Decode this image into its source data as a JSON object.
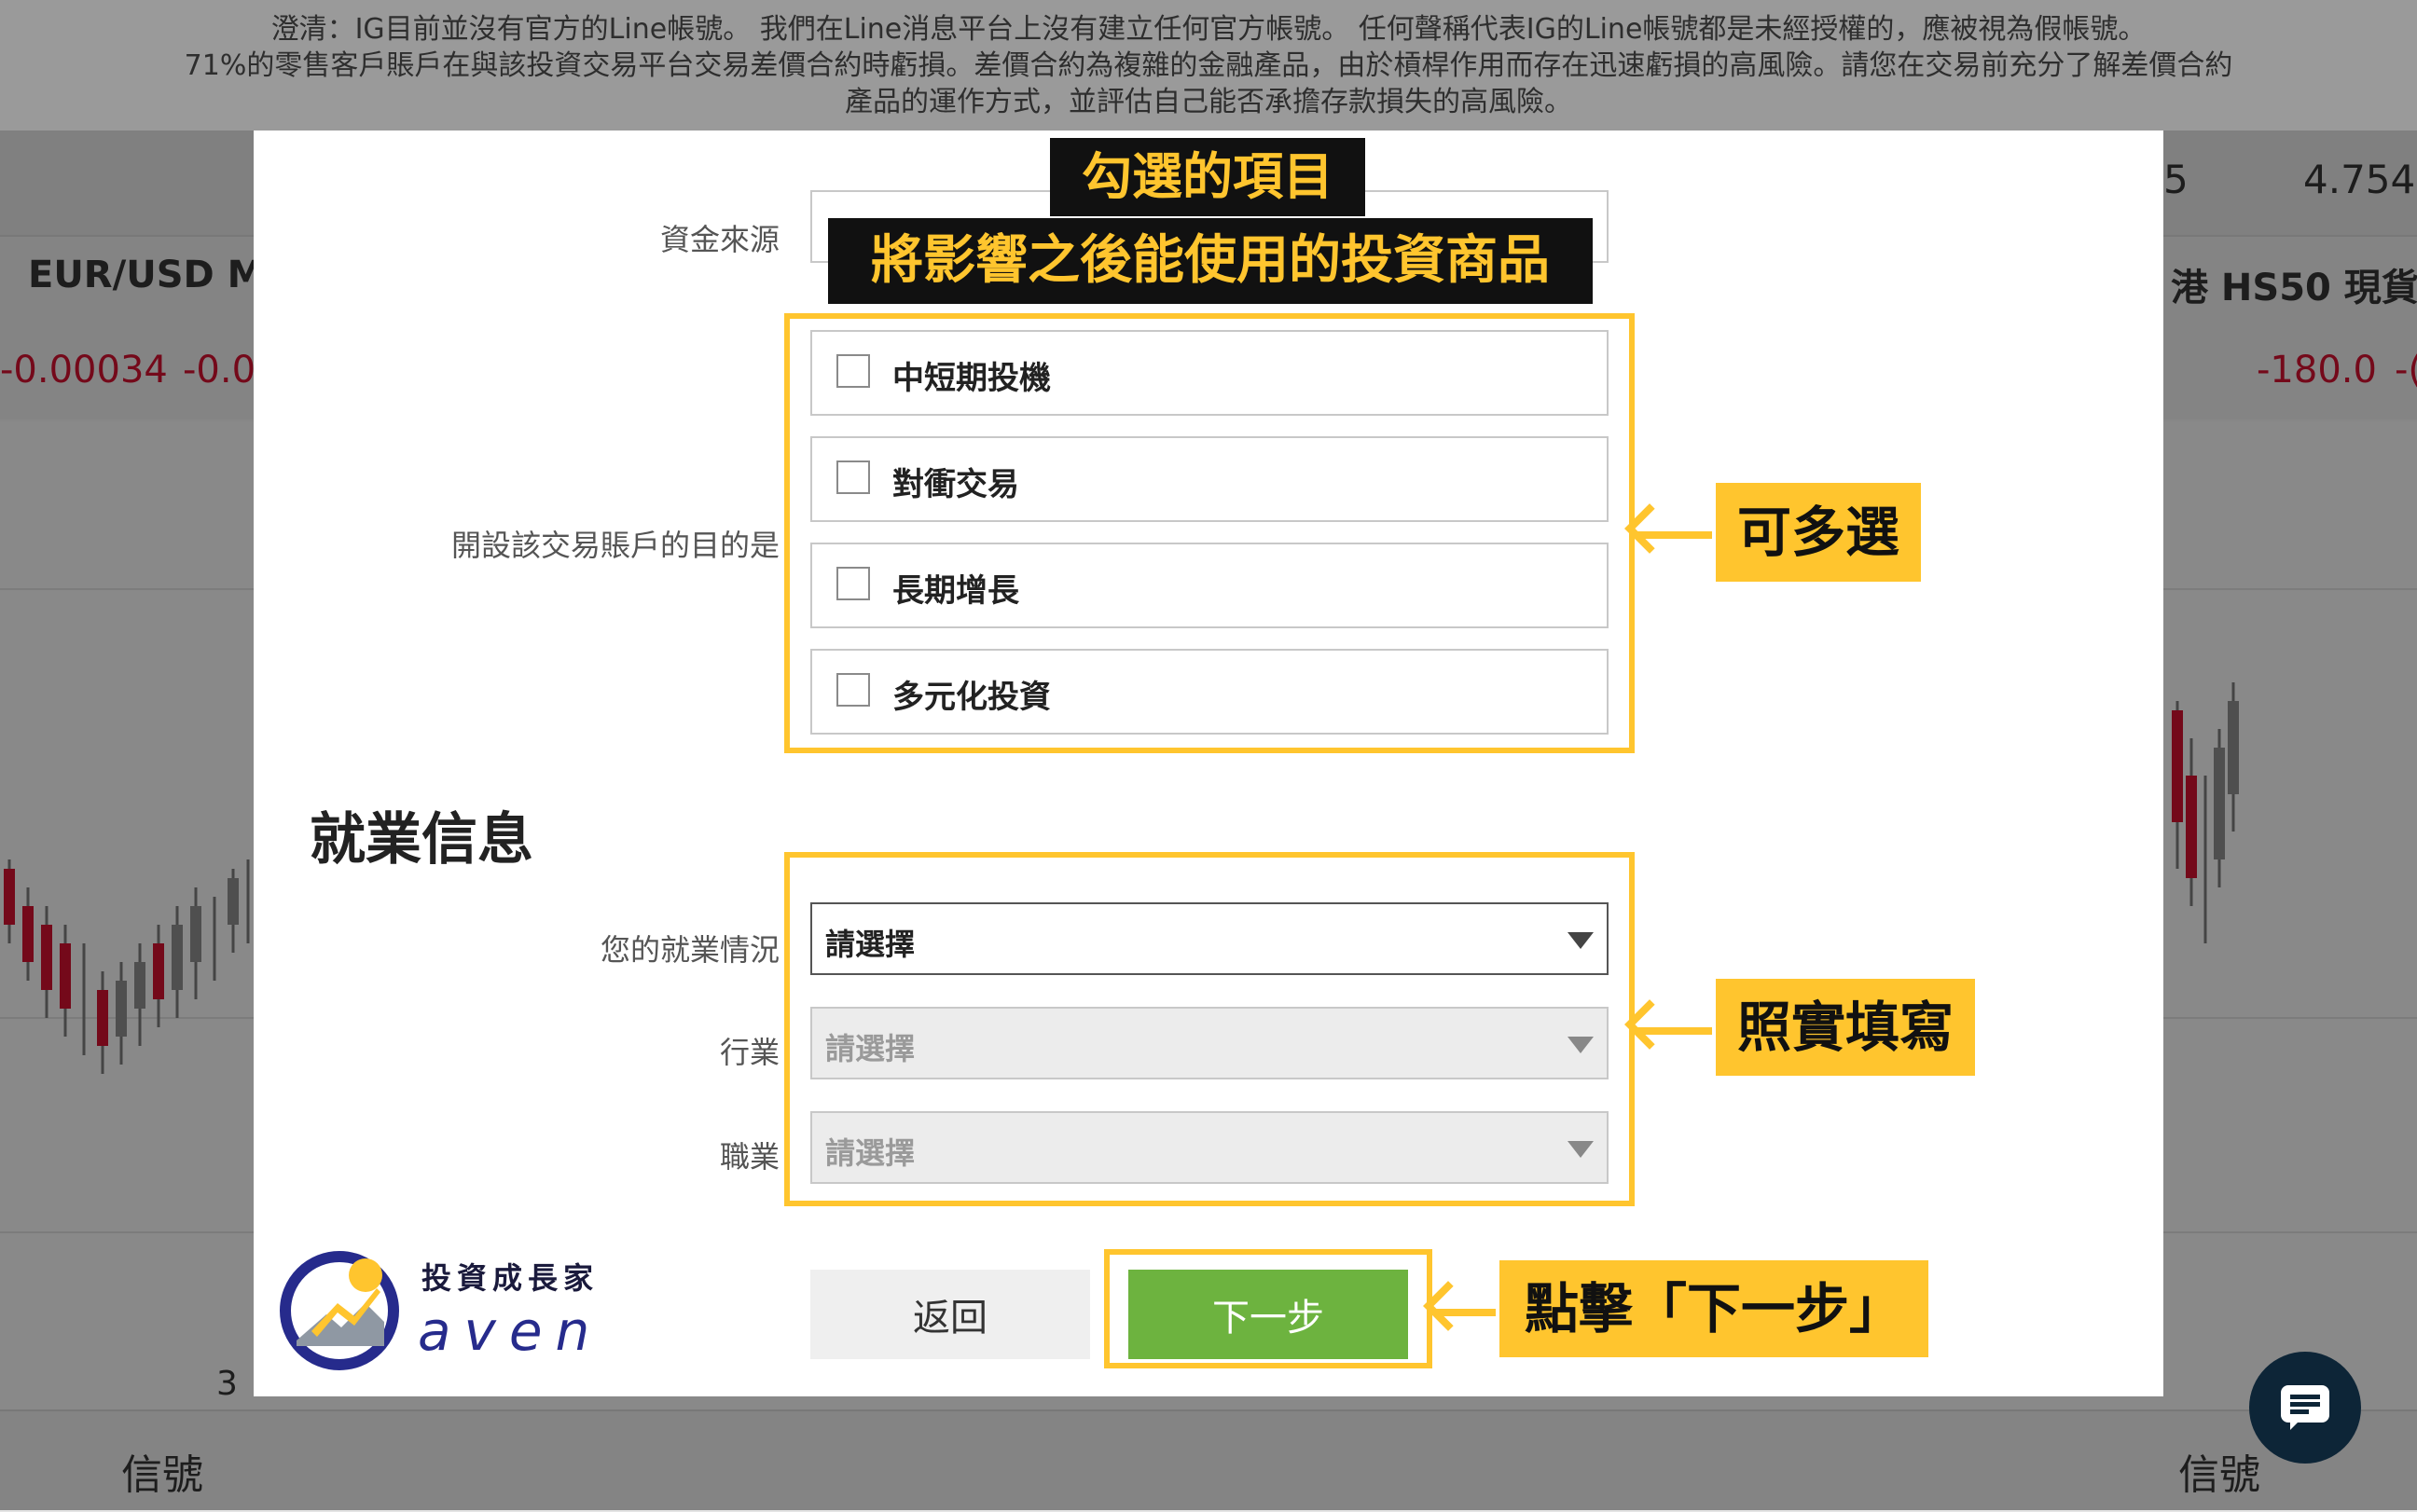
{
  "disclaimer": {
    "line1": "澄清：IG目前並沒有官方的Line帳號。 我們在Line消息平台上沒有建立任何官方帳號。 任何聲稱代表IG的Line帳號都是未經授權的，應被視為假帳號。",
    "line2": "71%的零售客戶賬戶在與該投資交易平台交易差價合約時虧損。差價合約為複雜的金融產品，由於槓桿作用而存在迅速虧損的高風險。請您在交易前充分了解差價合約",
    "line3": "產品的運作方式，並評估自己能否承擔存款損失的高風險。"
  },
  "background": {
    "left_market": "EUR/USD Mi",
    "left_change": "-0.00034",
    "left_change2": "-0.0",
    "right_price_a": "5",
    "right_price_b": "4.754",
    "right_market": "港 HS50 現貨",
    "right_change": "-180.0",
    "right_change2": "-(",
    "bottom_left": "信號",
    "bottom_right": "信號",
    "left_num": "3"
  },
  "form": {
    "source_label": "資金來源",
    "purpose_label": "開設該交易賬戶的目的是",
    "purpose_options": [
      {
        "label": "中短期投機",
        "checked": false
      },
      {
        "label": "對衝交易",
        "checked": false
      },
      {
        "label": "長期增長",
        "checked": false
      },
      {
        "label": "多元化投資",
        "checked": false
      }
    ],
    "employment_title": "就業信息",
    "employment_status_label": "您的就業情況",
    "employment_status_value": "請選擇",
    "industry_label": "行業",
    "industry_value": "請選擇",
    "occupation_label": "職業",
    "occupation_value": "請選擇",
    "back_label": "返回",
    "next_label": "下一步"
  },
  "annotations": {
    "header_line1": "勾選的項目",
    "header_line2": "將影響之後能使用的投資商品",
    "multi_select": "可多選",
    "fill_truthfully": "照實填寫",
    "click_next": "點擊「下一步」"
  },
  "logo": {
    "zh": "投資成長家",
    "en": "aven"
  },
  "colors": {
    "highlight": "#ffc52e",
    "next_button": "#6db33f",
    "chat_fab": "#0d2537"
  }
}
